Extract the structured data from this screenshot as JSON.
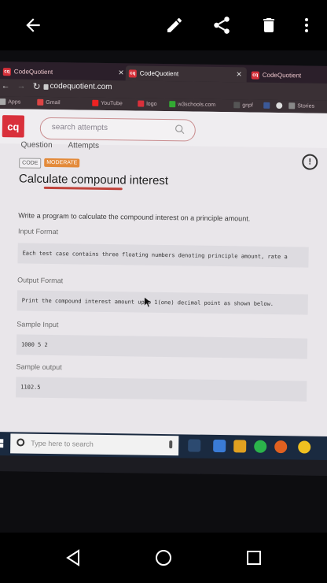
{
  "viewer": {
    "icons": [
      "back-arrow-icon",
      "edit-pencil-icon",
      "share-icon",
      "delete-trash-icon",
      "more-vert-icon"
    ]
  },
  "browser": {
    "tabs": [
      {
        "label": "CodeQuotient"
      },
      {
        "label": "CodeQuotient"
      },
      {
        "label": "CodeQuotient"
      }
    ],
    "address": "codequotient.com",
    "bookmarks": [
      "Apps",
      "Gmail",
      "YouTube",
      "logo",
      "w3schools.com",
      "gnpf",
      "",
      "",
      "Stories"
    ]
  },
  "page": {
    "logo": "cq",
    "search_placeholder": "search attempts",
    "tab_question": "Question",
    "tab_attempts": "Attempts",
    "badge_code": "CODE",
    "badge_level": "MODERATE",
    "title": "Calculate compound interest",
    "description": "Write a program to calculate the compound interest on a principle amount.",
    "input_format_label": "Input Format",
    "input_format_text": "Each test case contains three floating numbers denoting principle amount, rate a",
    "output_format_label": "Output Format",
    "output_format_text": "Print the compound interest amount upto 1(one) decimal point as shown below.",
    "sample_input_label": "Sample Input",
    "sample_input_text": "1000 5 2",
    "sample_output_label": "Sample output",
    "sample_output_text": "1102.5",
    "alert_icon": "!"
  },
  "taskbar": {
    "search_placeholder": "Type here to search"
  },
  "colors": {
    "brand": "#d9303b",
    "background": "#e9e6ea",
    "moderate_badge": "#e38a3a"
  }
}
